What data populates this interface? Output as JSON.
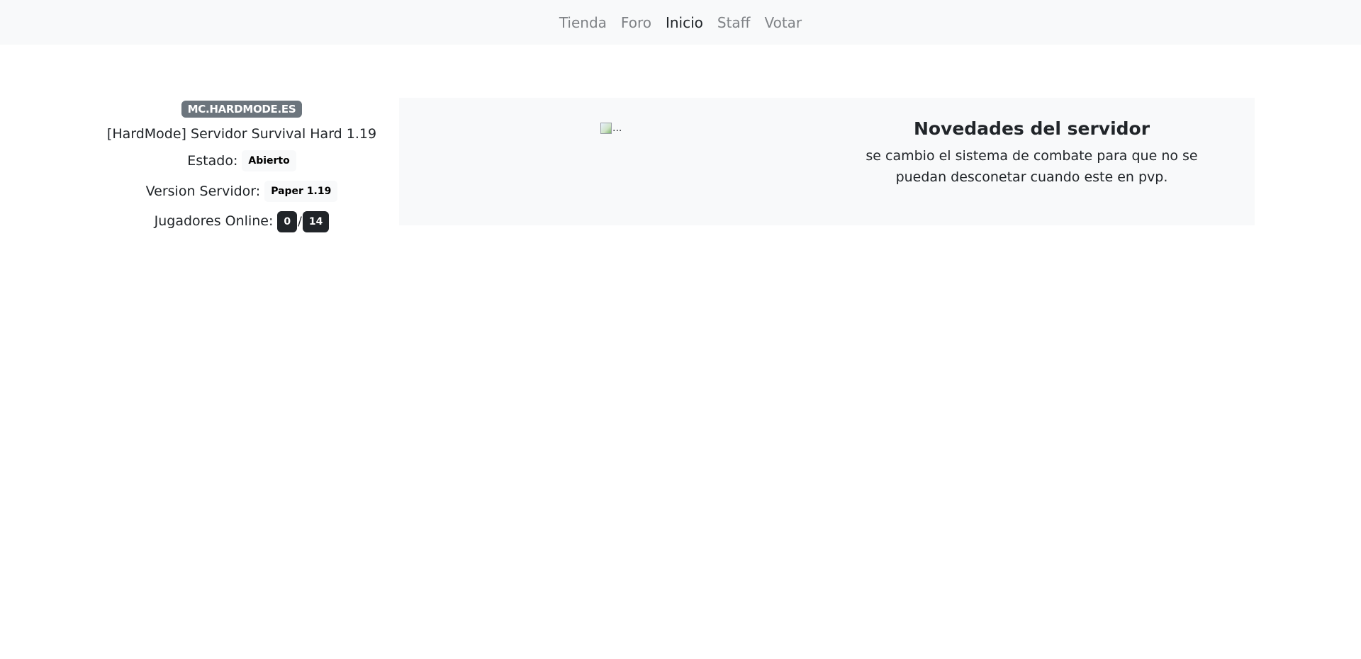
{
  "nav": {
    "items": [
      {
        "label": "Tienda",
        "active": false
      },
      {
        "label": "Foro",
        "active": false
      },
      {
        "label": "Inicio",
        "active": true
      },
      {
        "label": "Staff",
        "active": false
      },
      {
        "label": "Votar",
        "active": false
      }
    ]
  },
  "server": {
    "address": "MC.HARDMODE.ES",
    "title": "[HardMode] Servidor Survival Hard 1.19",
    "estado_label": "Estado:",
    "estado_value": "Abierto",
    "version_label": "Version Servidor:",
    "version_value": "Paper 1.19",
    "players_label": "Jugadores Online:",
    "players_online": "0",
    "players_sep": "/",
    "players_max": "14"
  },
  "news": {
    "image_alt": "...",
    "title": "Novedades del servidor",
    "body": "se cambio el sistema de combate para que no se puedan desconetar cuando este en pvp."
  },
  "colors": {
    "navbar_bg": "#f8f9fa",
    "nav_active": "#212529",
    "nav_inactive": "#7f8286",
    "badge_secondary": "#6c757d",
    "badge_dark": "#212529",
    "panel_bg": "#f8f9fa"
  }
}
